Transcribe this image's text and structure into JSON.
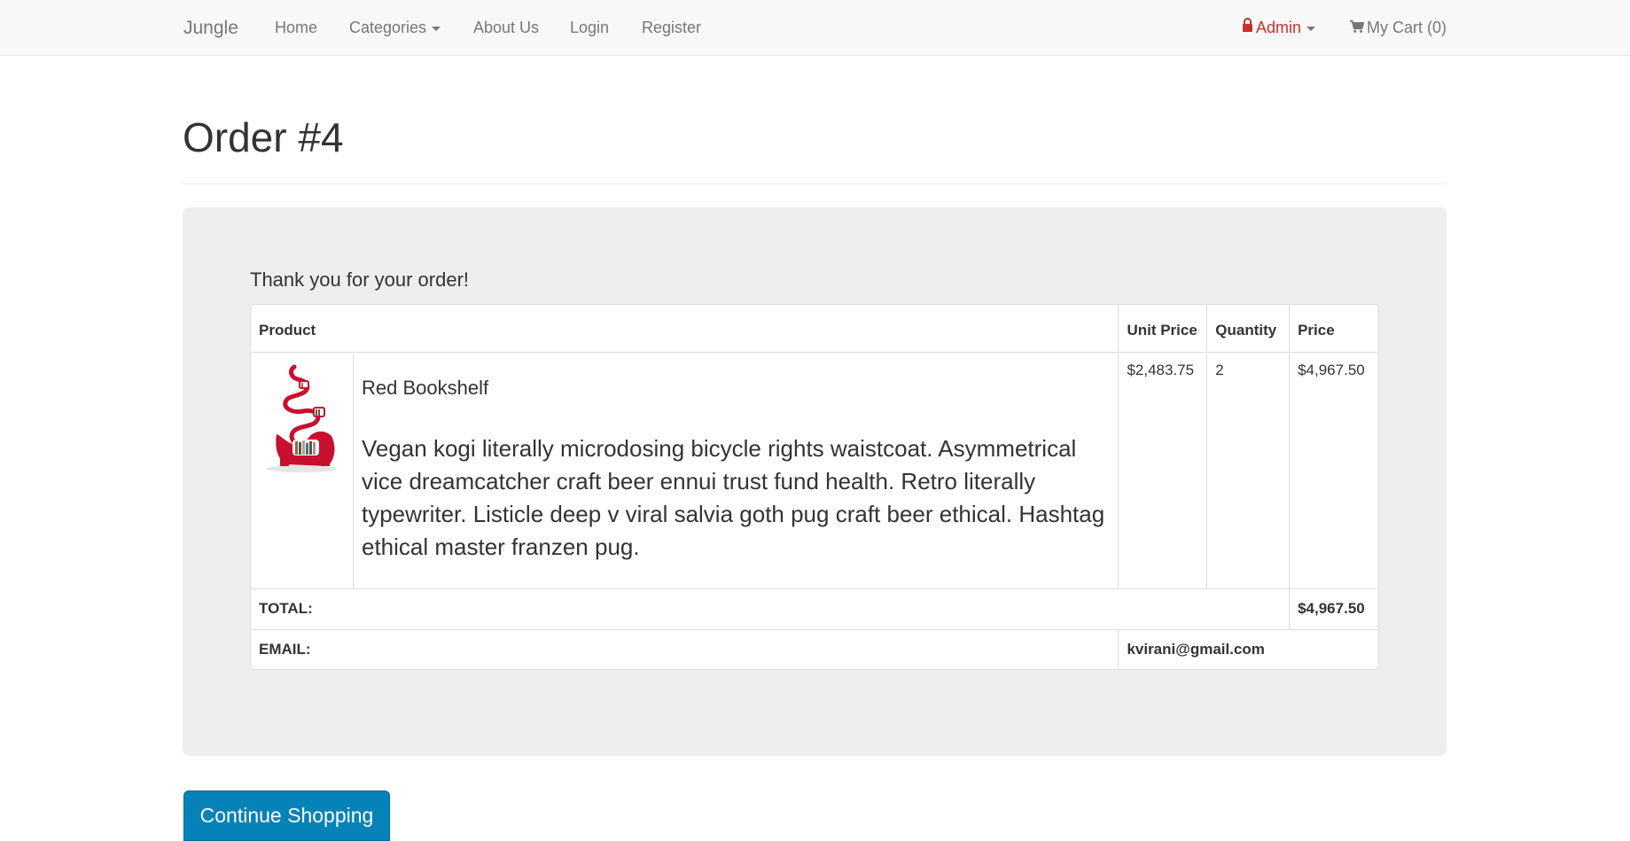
{
  "navbar": {
    "brand": "Jungle",
    "links": {
      "home": "Home",
      "categories": "Categories",
      "about": "About Us",
      "login": "Login",
      "register": "Register"
    },
    "admin": "Admin",
    "cart": "My Cart (0)"
  },
  "page": {
    "title": "Order #4",
    "thanks": "Thank you for your order!"
  },
  "table": {
    "headers": {
      "product": "Product",
      "unit_price": "Unit Price",
      "quantity": "Quantity",
      "price": "Price"
    },
    "items": [
      {
        "name": "Red Bookshelf",
        "description": "Vegan kogi literally microdosing bicycle rights waistcoat. Asymmetrical vice dreamcatcher craft beer ennui trust fund health. Retro literally typewriter. Listicle deep v viral salvia goth pug craft beer ethical. Hashtag ethical master franzen pug.",
        "unit_price": "$2,483.75",
        "quantity": "2",
        "price": "$4,967.50"
      }
    ],
    "total_label": "TOTAL:",
    "total_value": "$4,967.50",
    "email_label": "EMAIL:",
    "email_value": "kvirani@gmail.com"
  },
  "buttons": {
    "continue_shopping": "Continue Shopping"
  },
  "colors": {
    "primary_button": "#0582b8",
    "admin_red": "#c9302c",
    "navbar_bg": "#f8f8f8",
    "jumbotron_bg": "#eeeeee"
  },
  "icons": {
    "admin": "lock-icon",
    "cart": "shopping-cart-icon",
    "product_image": "red-bookshelf-image"
  }
}
